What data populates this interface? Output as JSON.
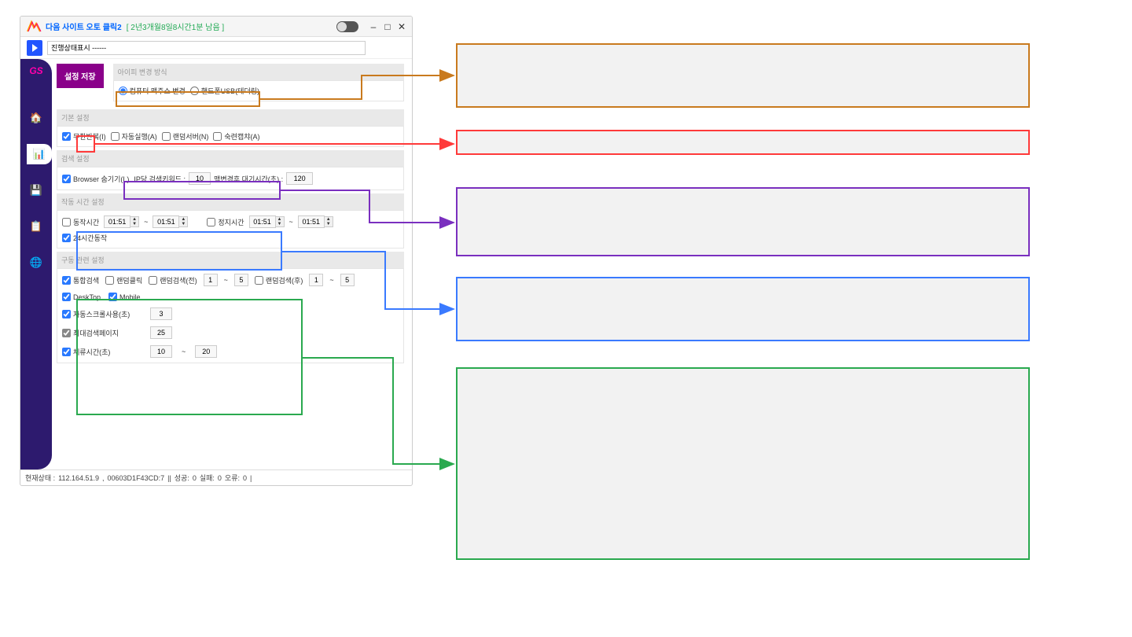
{
  "titlebar": {
    "app_title": "다음 사이트 오토 클릭2",
    "suffix": "[ 2년3개월8일8시간1분 남음 ]",
    "min": "–",
    "max": "□",
    "close": "✕"
  },
  "status_input": "진행상태표시 ------",
  "sidebar": {
    "brand": "GS"
  },
  "save_button": "설정 저장",
  "sections": {
    "ip_change": {
      "header": "아이피 변경 방식",
      "opt1": "컴퓨터 맥주소 변경",
      "opt2": "핸드폰USB(테더링)"
    },
    "basic": {
      "header": "기본 설정",
      "c1": "무한반복(I)",
      "c2": "자동실행(A)",
      "c3": "랜덤서버(N)",
      "c4": "숙련캡챠(A)"
    },
    "search": {
      "header": "검색 설정",
      "browser_hide": "Browser 숨기기(L)",
      "ip_keyword_label": "IP당 검색키워드 :",
      "ip_keyword_value": "10",
      "mac_wait_label": "맥변경후 대기시간(초) :",
      "mac_wait_value": "120"
    },
    "worktime": {
      "header": "작동 시간 설정",
      "work_label": "동작시간",
      "work_from": "01:51",
      "work_to": "01:51",
      "stop_label": "정지시간",
      "stop_from": "01:51",
      "stop_to": "01:51",
      "h24": "24시간동작"
    },
    "drive": {
      "header": "구동 관련 설정",
      "c_total": "통합검색",
      "c_randclick": "랜덤클릭",
      "c_randsearch_pre": "랜덤검색(전)",
      "rand_pre_lo": "1",
      "rand_pre_hi": "5",
      "c_randsearch_post": "랜덤검색(후)",
      "rand_post_lo": "1",
      "rand_post_hi": "5",
      "c_desktop": "DeskTop",
      "c_mobile": "Mobile",
      "c_autoscroll": "자동스크롤사용(초)",
      "autoscroll_v": "3",
      "c_maxpage": "최대검색페이지",
      "maxpage_v": "25",
      "c_stay": "체류시간(초)",
      "stay_lo": "10",
      "stay_hi": "20"
    }
  },
  "statusbar": {
    "label": "현재상태 :",
    "ip": "112.164.51.9",
    "mac": "00603D1F43CD:7",
    "success_label": "성공:",
    "success_v": "0",
    "fail_label": "실패:",
    "fail_v": "0",
    "err_label": "오류:",
    "err_v": "0"
  },
  "colors": {
    "orange": "#c97a1e",
    "red": "#ff3a3a",
    "purple": "#7a2fbf",
    "blue": "#3a7aff",
    "green": "#2aa94f"
  }
}
